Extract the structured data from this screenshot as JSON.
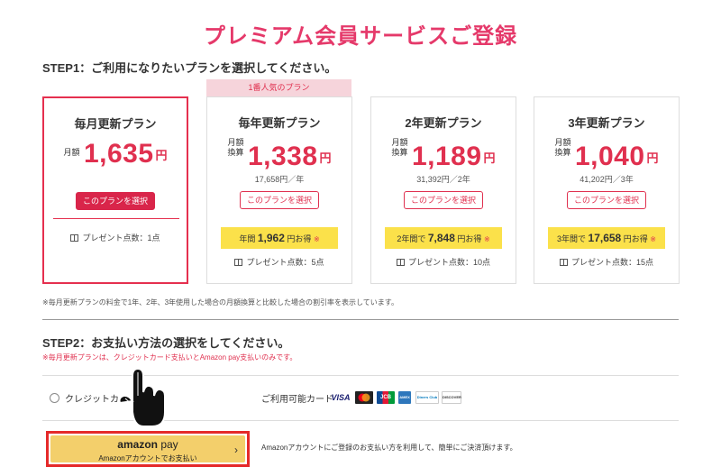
{
  "page": {
    "title": "プレミアム会員サービスご登録",
    "step1": "STEP1：ご利用になりたいプランを選択してください。",
    "step2": "STEP2：お支払い方法の選択をしてください。"
  },
  "popular_badge": "1番人気のプラン",
  "plans": [
    {
      "name": "毎月更新プラン",
      "price_label": "月額",
      "price": "1,635",
      "unit": "円",
      "sub": "",
      "button": "このプランを選択",
      "savings_prefix": "",
      "savings_amount": "",
      "savings_suffix": "",
      "savings_mark": "",
      "points": "プレゼント点数：1点"
    },
    {
      "name": "毎年更新プラン",
      "price_label_1": "月額",
      "price_label_2": "換算",
      "price": "1,338",
      "unit": "円",
      "sub": "17,658円／年",
      "button": "このプランを選択",
      "savings_prefix": "年間",
      "savings_amount": "1,962",
      "savings_suffix": "円お得",
      "savings_mark": "※",
      "points": "プレゼント点数：5点"
    },
    {
      "name": "2年更新プラン",
      "price_label_1": "月額",
      "price_label_2": "換算",
      "price": "1,189",
      "unit": "円",
      "sub": "31,392円／2年",
      "button": "このプランを選択",
      "savings_prefix": "2年間で",
      "savings_amount": "7,848",
      "savings_suffix": "円お得",
      "savings_mark": "※",
      "points": "プレゼント点数：10点"
    },
    {
      "name": "3年更新プラン",
      "price_label_1": "月額",
      "price_label_2": "換算",
      "price": "1,040",
      "unit": "円",
      "sub": "41,202円／3年",
      "button": "このプランを選択",
      "savings_prefix": "3年間で",
      "savings_amount": "17,658",
      "savings_suffix": "円お得",
      "savings_mark": "※",
      "points": "プレゼント点数：15点"
    }
  ],
  "note1": "※毎月更新プランの料金で1年、2年、3年使用した場合の月額換算と比較した場合の割引率を表示しています。",
  "note2": "※毎月更新プランは、クレジットカード支払いとAmazon pay支払いのみです。",
  "payment": {
    "credit_label": "クレジットカ",
    "available_cards_label": "ご利用可能カード",
    "card_logos": [
      "VISA",
      "MasterCard",
      "JCB",
      "AMEX",
      "Diners Club",
      "DISCOVER"
    ],
    "amazon_logo_1": "amazon",
    "amazon_logo_2": "pay",
    "amazon_sub": "Amazonアカウントでお支払い",
    "amazon_chevron": "›",
    "amazon_desc": "Amazonアカウントにご登録のお支払い方を利用して、簡単にご決済頂けます。"
  },
  "colors": {
    "accent": "#e5396a",
    "button_red": "#d9254a",
    "savings_yellow": "#fbe14a",
    "amazon_gold": "#f3cf6b",
    "highlight_red": "#e52a2a"
  },
  "icons": {
    "gift": "gift-icon",
    "pointer": "pointing-hand-icon",
    "chevron": "chevron-right-icon"
  }
}
